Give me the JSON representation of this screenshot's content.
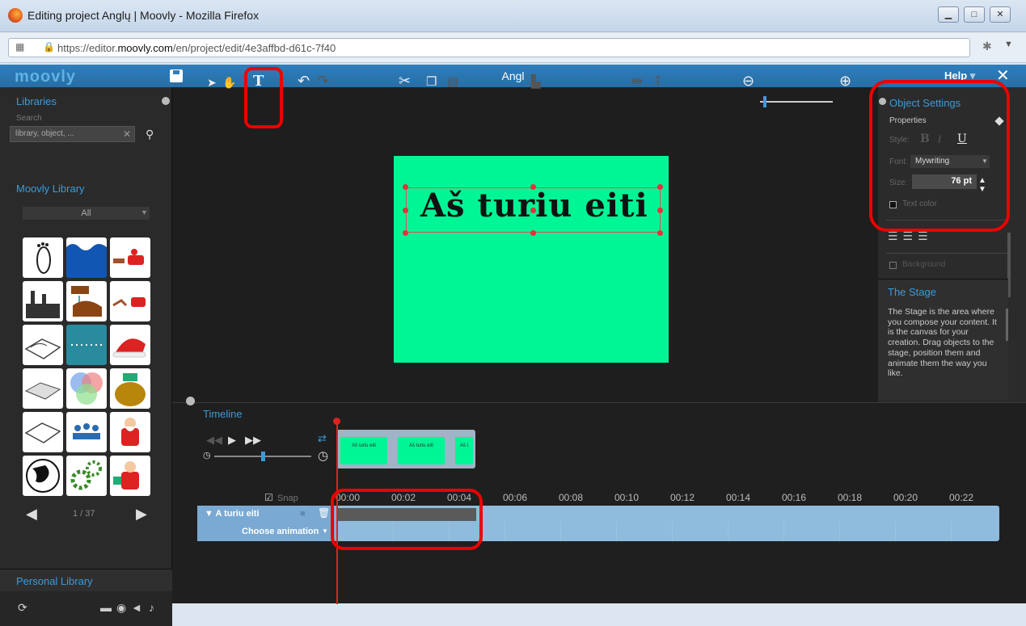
{
  "browser": {
    "window_title": "Editing project Anglų | Moovly - Mozilla Firefox",
    "url_prefix": "https://editor.",
    "url_domain": "moovly.com",
    "url_suffix": "/en/project/edit/4e3affbd-d61c-7f40"
  },
  "app": {
    "logo": "moovly",
    "project_name": "Angl",
    "help_label": "Help",
    "close_label": "✕"
  },
  "libraries": {
    "title": "Libraries",
    "search_label": "Search",
    "search_placeholder": "library, object, ...",
    "moovly_library_title": "Moovly Library",
    "filter_value": "All",
    "page": "1 / 37",
    "personal_library_title": "Personal Library",
    "thumbnails": [
      "footprint",
      "wave",
      "santa-sleigh",
      "factory",
      "hand-washing",
      "reindeer-sleigh",
      "landscape-map",
      "dotted-line",
      "santa-hat",
      "terrain-map",
      "venn-circles",
      "gift-sack",
      "terrain-relief",
      "meeting",
      "santa-claus",
      "globe",
      "gears",
      "santa-gift"
    ]
  },
  "toolbar": {
    "select_icon": "pointer-icon",
    "hand_icon": "hand-icon",
    "text_icon": "text-icon",
    "undo_icon": "undo-icon",
    "redo_icon": "redo-icon",
    "cut_icon": "scissors-icon",
    "copy_icon": "copy-icon",
    "paste_icon": "paste-icon",
    "align_icon": "align-icon",
    "zoom_out_icon": "zoom-out-icon",
    "zoom_in_icon": "zoom-in-icon"
  },
  "stage": {
    "background_color": "#00f595",
    "text": "Aš turiu eiti"
  },
  "object_settings": {
    "title": "Object Settings",
    "properties_label": "Properties",
    "style_label": "Style:",
    "bold": "B",
    "italic": "I",
    "underline": "U",
    "font_label": "Font:",
    "font_value": "Mywriting",
    "size_label": "Size:",
    "size_value": "76 pt",
    "text_color_label": "Text color",
    "background_label": "Background"
  },
  "stage_info": {
    "title": "The Stage",
    "description": "The Stage is the area where you compose your content. It is the canvas for your creation. Drag objects to the stage, position them and animate them the way you like."
  },
  "timeline": {
    "title": "Timeline",
    "snap_label": "Snap",
    "clip_labels": [
      "Aš turiu eiti",
      "Aš turiu eiti",
      "Aš t"
    ],
    "ticks": [
      "00:00",
      "00:02",
      "00:04",
      "00:06",
      "00:08",
      "00:10",
      "00:12",
      "00:14",
      "00:16",
      "00:18",
      "00:20",
      "00:22"
    ],
    "track_name": "▼ A turiu eiti",
    "choose_animation": "Choose animation"
  },
  "colors": {
    "accent": "#3d9ad8",
    "topbar": "#2f7ebc",
    "highlight": "#e00000",
    "stage": "#00f595"
  }
}
